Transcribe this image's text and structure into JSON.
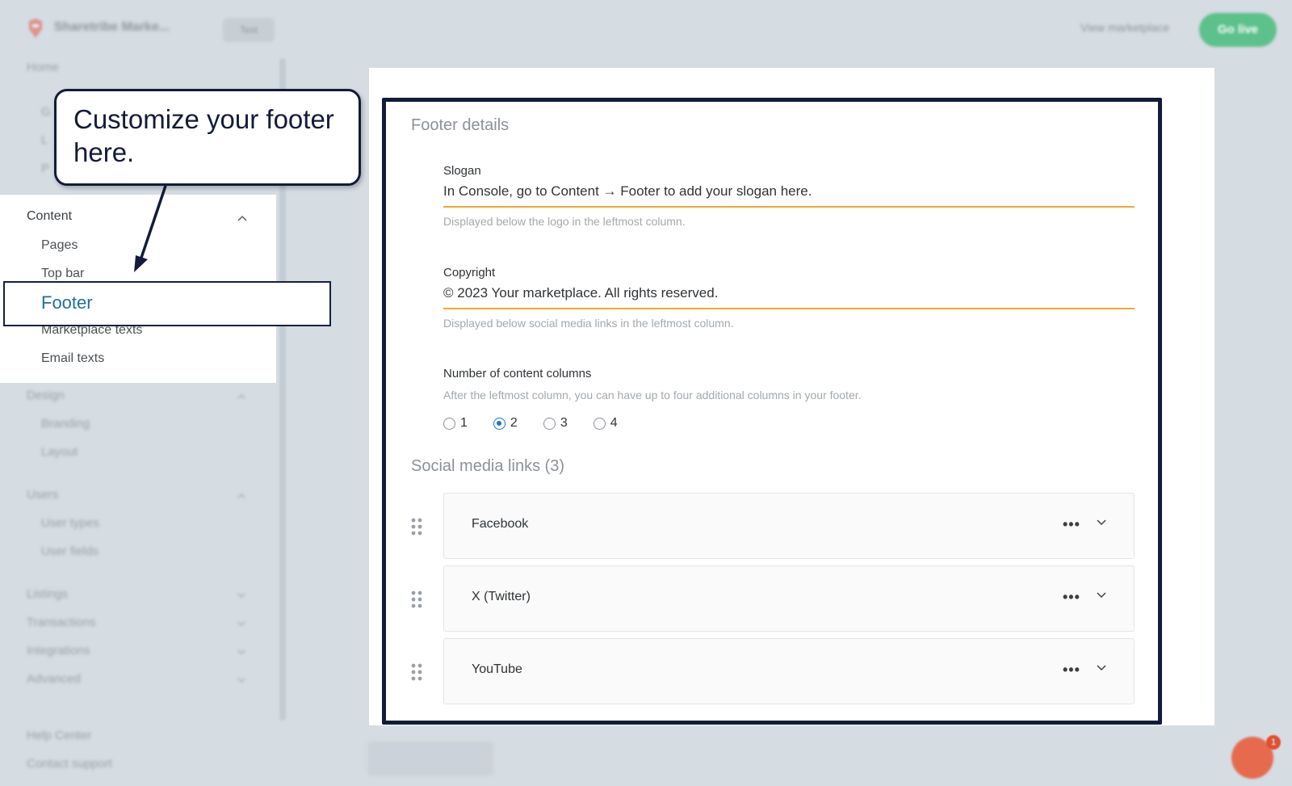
{
  "topbar": {
    "brand": "Sharetribe Marke...",
    "env_label": "Test",
    "view_marketplace": "View marketplace",
    "go_live": "Go live"
  },
  "sidebar": {
    "home": "Home",
    "hidden_items": [
      "G",
      "L",
      "P"
    ],
    "content": {
      "label": "Content",
      "items": [
        "Pages",
        "Top bar",
        "Footer",
        "Marketplace texts",
        "Email texts"
      ],
      "selected": "Footer"
    },
    "design": {
      "label": "Design",
      "items": [
        "Branding",
        "Layout"
      ]
    },
    "users": {
      "label": "Users",
      "items": [
        "User types",
        "User fields"
      ]
    },
    "collapsed": [
      "Listings",
      "Transactions",
      "Integrations",
      "Advanced"
    ],
    "bottom": [
      "Help Center",
      "Contact support"
    ]
  },
  "callout": {
    "text": "Customize your footer here."
  },
  "footer_details": {
    "title": "Footer details",
    "slogan": {
      "label": "Slogan",
      "value": "In Console, go to Content → Footer to add your slogan here.",
      "help": "Displayed below the logo in the leftmost column."
    },
    "copyright": {
      "label": "Copyright",
      "value": "© 2023 Your marketplace. All rights reserved.",
      "help": "Displayed below social media links in the leftmost column."
    },
    "columns": {
      "label": "Number of content columns",
      "help": "After the leftmost column, you can have up to four additional columns in your footer.",
      "options": [
        "1",
        "2",
        "3",
        "4"
      ],
      "selected": "2"
    }
  },
  "social": {
    "title": "Social media links (3)",
    "items": [
      "Facebook",
      "X (Twitter)",
      "YouTube"
    ]
  },
  "chat": {
    "badge": "1"
  },
  "colors": {
    "accent_underline": "#f0a830",
    "selected_text": "#1f6f9a",
    "frame": "#131b3a",
    "go_live": "#5cc18a"
  }
}
